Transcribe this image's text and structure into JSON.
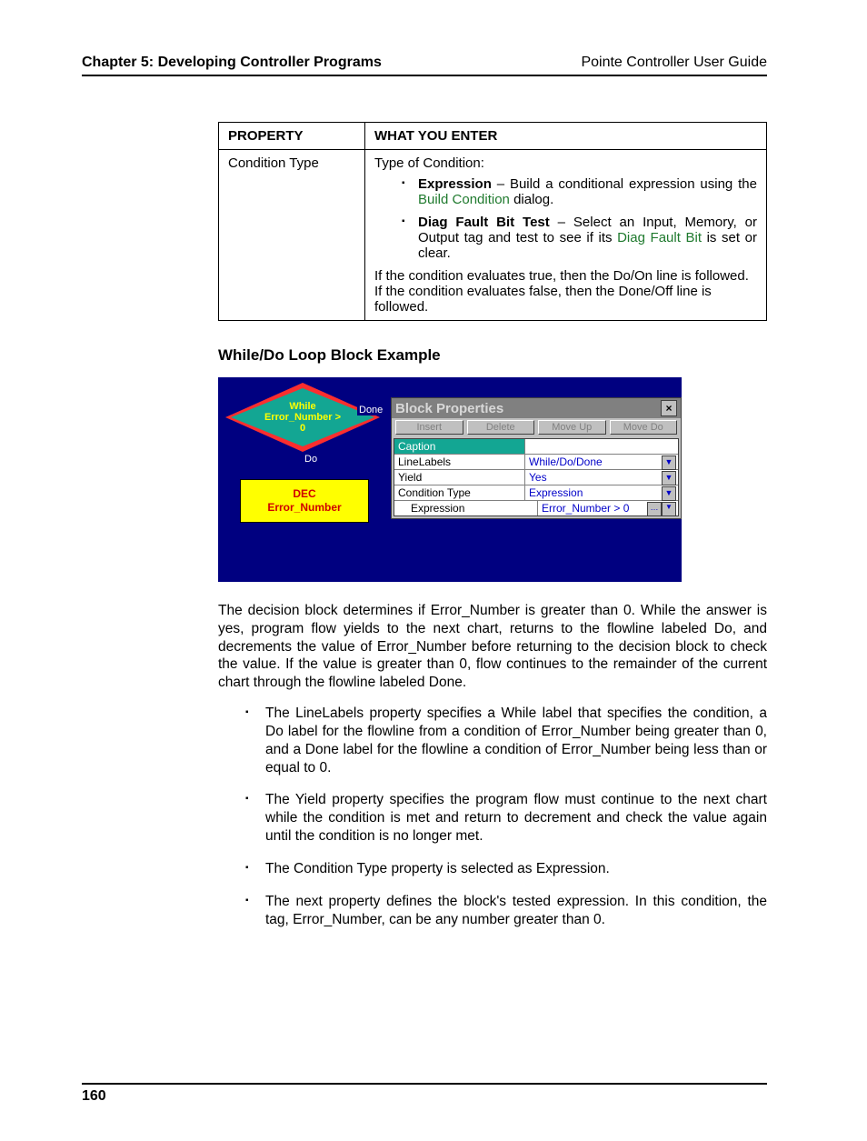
{
  "header": {
    "left": "Chapter 5: Developing Controller Programs",
    "right": "Pointe Controller User Guide"
  },
  "table": {
    "head": {
      "col1": "Property",
      "col2": "What You Enter"
    },
    "row": {
      "col1": "Condition Type",
      "intro": "Type of Condition:",
      "item1": {
        "bold": "Expression",
        "rest": " – Build a conditional expression using the ",
        "link": "Build Condition",
        "tail": " dialog."
      },
      "item2": {
        "bold": "Diag Fault Bit Test",
        "rest": " – Select an Input, Memory, or Output tag and test to see if its ",
        "link": "Diag Fault Bit",
        "tail": " is set or clear."
      },
      "outro": "If the condition evaluates true, then the Do/On line is followed. If the condition evaluates false, then the Done/Off line is followed."
    }
  },
  "section_title": "While/Do Loop Block Example",
  "screenshot": {
    "diamond": {
      "l1": "While",
      "l2": "Error_Number >",
      "l3": "0"
    },
    "done": "Done",
    "do": "Do",
    "dec": {
      "l1": "DEC",
      "l2": "Error_Number"
    },
    "panel": {
      "title": "Block Properties",
      "buttons": {
        "insert": "Insert",
        "delete": "Delete",
        "moveup": "Move Up",
        "movedown": "Move Do"
      },
      "rows": {
        "caption": {
          "label": "Caption",
          "value": ""
        },
        "linelabels": {
          "label": "LineLabels",
          "value": "While/Do/Done"
        },
        "yield": {
          "label": "Yield",
          "value": "Yes"
        },
        "condtype": {
          "label": "Condition Type",
          "value": "Expression"
        },
        "expression": {
          "label": "Expression",
          "value": "Error_Number > 0"
        }
      }
    }
  },
  "para1": "The decision block determines if Error_Number is greater than 0. While the answer is yes, program flow yields to the next chart, returns to the flowline labeled Do, and decrements the value of  Error_Number before returning to the decision block to check the value. If the value is greater than 0, flow continues to the remainder of the current chart through the flowline labeled Done.",
  "bullets": {
    "b1": "The LineLabels property specifies a While label that specifies the condition, a Do label for the flowline from a condition of Error_Number being greater than 0, and a Done label for the flowline a condition of Error_Number being less than or equal to 0.",
    "b2": "The Yield property specifies the program flow must continue to the next chart while the condition is met and return to decrement and check the value again until the condition is no longer met.",
    "b3": "The Condition Type property is selected as Expression.",
    "b4": "The next property defines the block's tested expression. In this condition, the tag, Error_Number, can be any number greater than 0."
  },
  "footer": {
    "page": "160"
  }
}
